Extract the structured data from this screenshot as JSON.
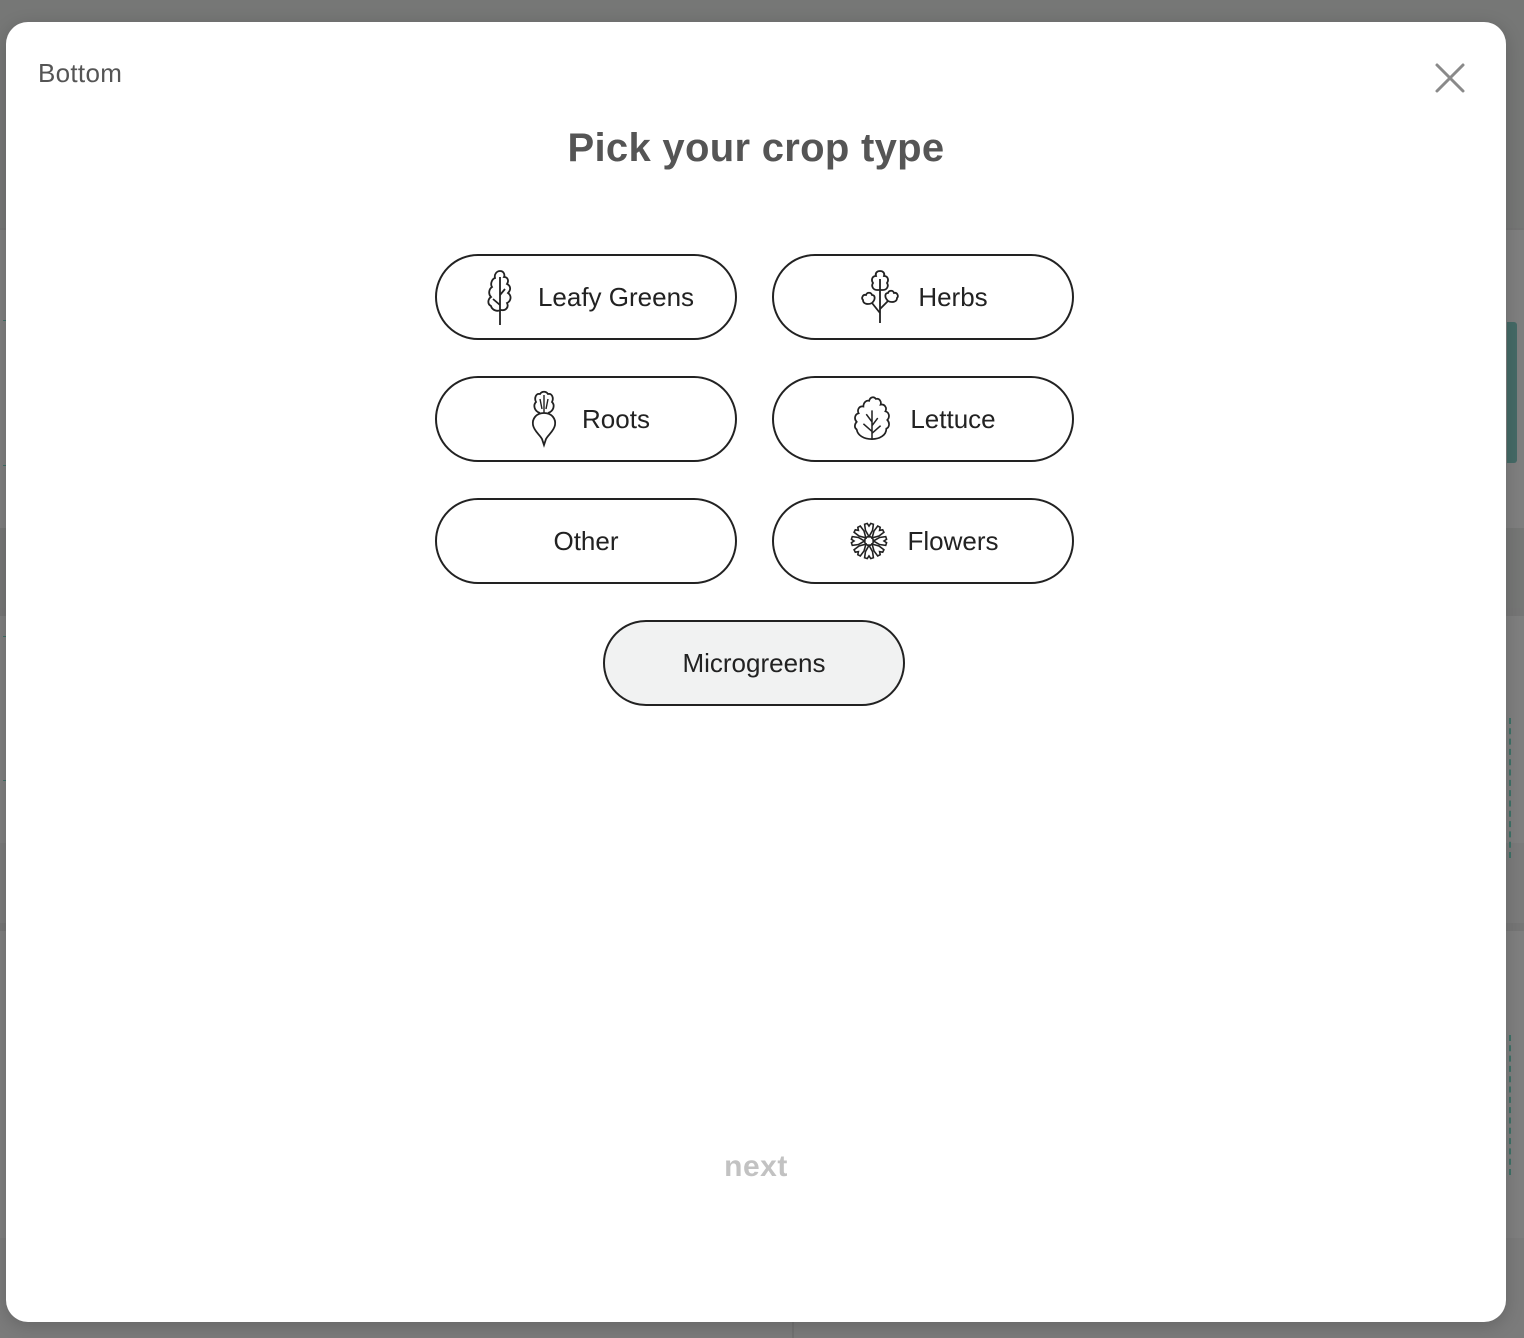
{
  "modal": {
    "context_label": "Bottom",
    "title": "Pick your crop type",
    "close_icon": "close-icon",
    "next_label": "next",
    "next_enabled": false
  },
  "options": [
    {
      "label": "Leafy Greens",
      "icon": "leafy-greens-icon",
      "selected": false
    },
    {
      "label": "Herbs",
      "icon": "herbs-icon",
      "selected": false
    },
    {
      "label": "Roots",
      "icon": "roots-icon",
      "selected": false
    },
    {
      "label": "Lettuce",
      "icon": "lettuce-icon",
      "selected": false
    },
    {
      "label": "Other",
      "icon": null,
      "selected": false
    },
    {
      "label": "Flowers",
      "icon": "flowers-icon",
      "selected": false
    },
    {
      "label": "Microgreens",
      "icon": null,
      "selected": true
    }
  ],
  "colors": {
    "overlay": "#7a7a7a",
    "modal_bg": "#ffffff",
    "title_text": "#555555",
    "option_border": "#222222",
    "option_selected_bg": "#f1f2f2",
    "next_disabled": "#c2c2c2",
    "background_accent": "#456a66"
  }
}
